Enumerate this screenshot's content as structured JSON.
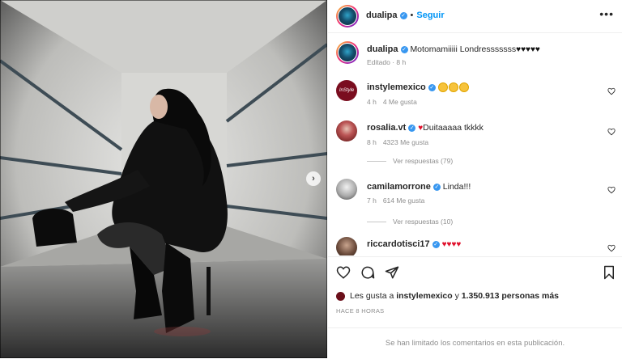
{
  "header": {
    "username": "dualipa",
    "separator": "•",
    "follow_label": "Seguir",
    "more_label": "•••"
  },
  "caption": {
    "username": "dualipa",
    "text": "Motomamiiiii Londresssssss",
    "edited": "Editado · 8 h"
  },
  "comments": [
    {
      "username": "instylemexico",
      "avatar_text": "InStyle",
      "time": "4 h",
      "likes": "4 Me gusta"
    },
    {
      "username": "rosalia.vt",
      "text": "Duitaaaaa tkkkk",
      "time": "8 h",
      "likes": "4323 Me gusta",
      "replies": "Ver respuestas (79)"
    },
    {
      "username": "camilamorrone",
      "text": "Linda!!!",
      "time": "7 h",
      "likes": "614 Me gusta",
      "replies": "Ver respuestas (10)"
    },
    {
      "username": "riccardotisci17"
    }
  ],
  "likes": {
    "prefix": "Les gusta a",
    "user": "instylemexico",
    "connector": "y",
    "count": "1.350.913 personas más"
  },
  "time_ago": "HACE 8 HORAS",
  "limited_notice": "Se han limitado los comentarios en esta publicación.",
  "colors": {
    "accent": "#0095f6",
    "verified": "#3897f0",
    "muted": "#8e8e8e",
    "text": "#262626"
  },
  "icons": [
    "next-arrow-icon",
    "verified-icon",
    "heart-icon",
    "comment-icon",
    "share-icon",
    "save-icon",
    "more-icon"
  ]
}
